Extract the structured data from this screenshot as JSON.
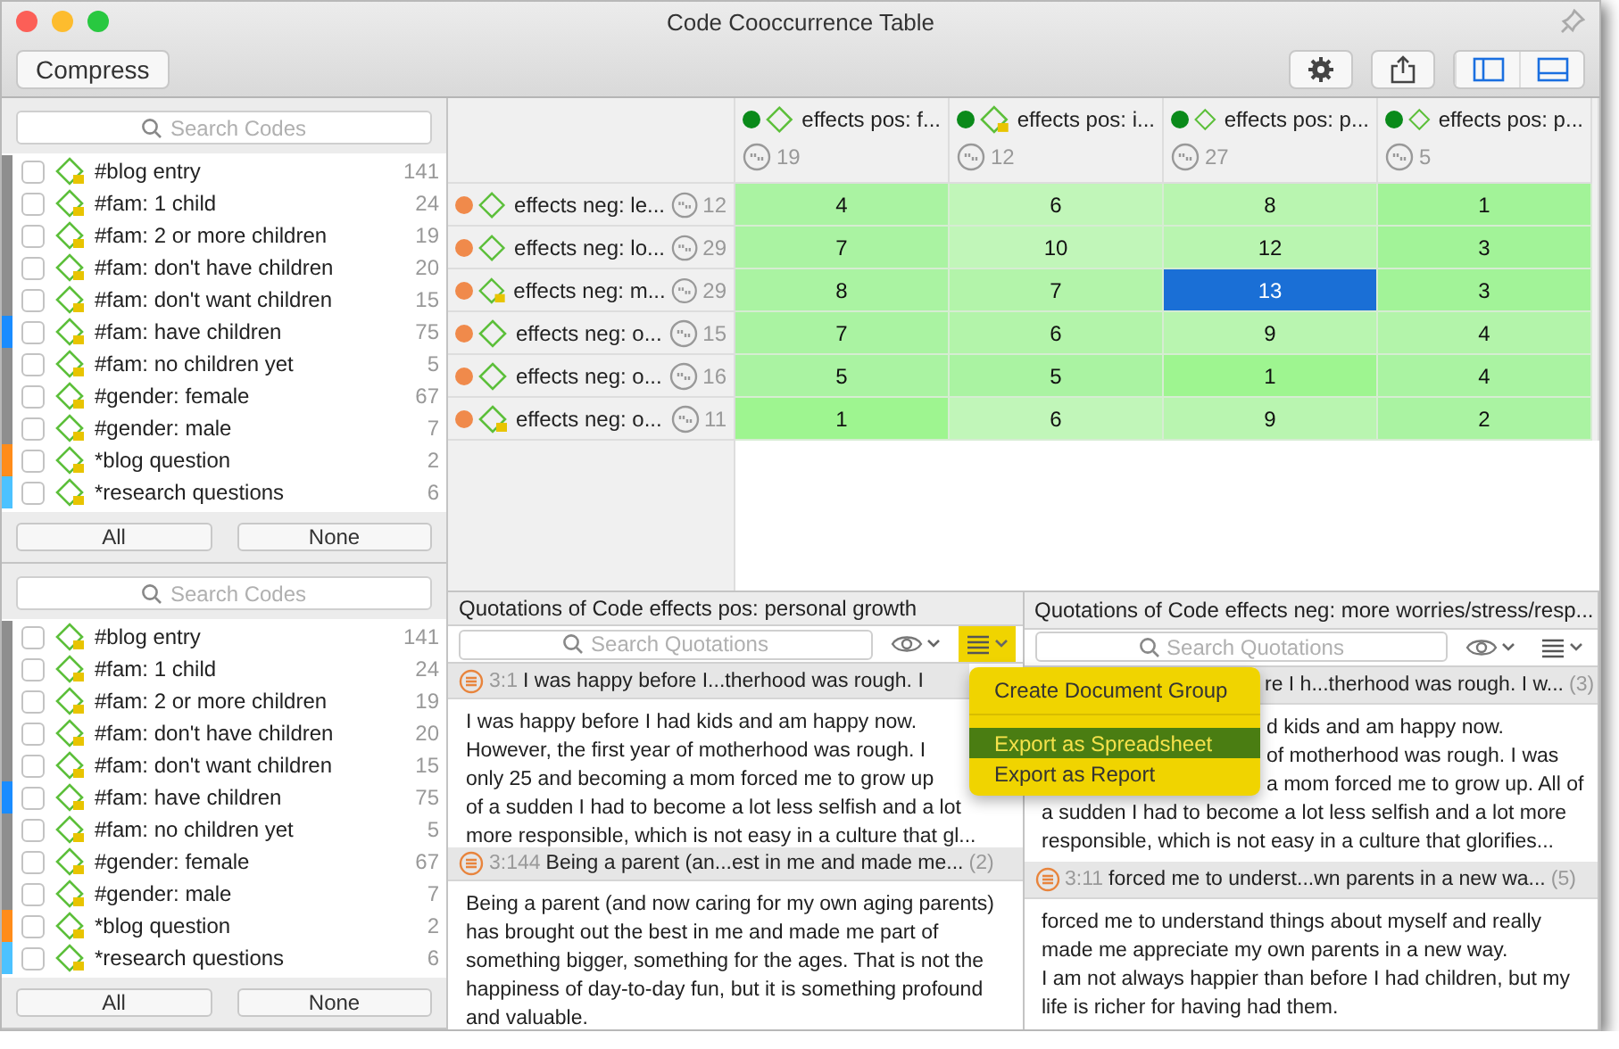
{
  "window": {
    "title": "Code Cooccurrence Table"
  },
  "toolbar": {
    "compress": "Compress",
    "panels": [
      {
        "kind": "left",
        "selected": true
      },
      {
        "kind": "bottom",
        "selected": true
      }
    ]
  },
  "code_lists": [
    {
      "search_placeholder": "Search Codes",
      "all": "All",
      "none": "None",
      "items": [
        {
          "name": "#blog entry",
          "count": "141",
          "color": "#8e8e8e",
          "checked": false,
          "memo": true
        },
        {
          "name": "#fam: 1 child",
          "count": "24",
          "color": "#8e8e8e",
          "checked": false,
          "memo": true
        },
        {
          "name": "#fam: 2 or more children",
          "count": "19",
          "color": "#8e8e8e",
          "checked": false,
          "memo": true
        },
        {
          "name": "#fam: don't have children",
          "count": "20",
          "color": "#8e8e8e",
          "checked": false,
          "memo": true
        },
        {
          "name": "#fam: don't want children",
          "count": "15",
          "color": "#8e8e8e",
          "checked": false,
          "memo": true
        },
        {
          "name": "#fam: have children",
          "count": "75",
          "color": "#1a8cff",
          "checked": false,
          "memo": true
        },
        {
          "name": "#fam: no children yet",
          "count": "5",
          "color": "#8e8e8e",
          "checked": false,
          "memo": true
        },
        {
          "name": "#gender: female",
          "count": "67",
          "color": "#8e8e8e",
          "checked": false,
          "memo": true
        },
        {
          "name": "#gender: male",
          "count": "7",
          "color": "#8e8e8e",
          "checked": false,
          "memo": true
        },
        {
          "name": "*blog question",
          "count": "2",
          "color": "#ff8c1a",
          "checked": false,
          "memo": true
        },
        {
          "name": "*research questions",
          "count": "6",
          "color": "#4cc2ff",
          "checked": false,
          "memo": true
        }
      ]
    },
    {
      "search_placeholder": "Search Codes",
      "all": "All",
      "none": "None",
      "items": [
        {
          "name": "#blog entry",
          "count": "141",
          "color": "#8e8e8e",
          "checked": false,
          "memo": true
        },
        {
          "name": "#fam: 1 child",
          "count": "24",
          "color": "#8e8e8e",
          "checked": false,
          "memo": true
        },
        {
          "name": "#fam: 2 or more children",
          "count": "19",
          "color": "#8e8e8e",
          "checked": false,
          "memo": true
        },
        {
          "name": "#fam: don't have children",
          "count": "20",
          "color": "#8e8e8e",
          "checked": false,
          "memo": true
        },
        {
          "name": "#fam: don't want children",
          "count": "15",
          "color": "#8e8e8e",
          "checked": false,
          "memo": true
        },
        {
          "name": "#fam: have children",
          "count": "75",
          "color": "#1a8cff",
          "checked": false,
          "memo": true
        },
        {
          "name": "#fam: no children yet",
          "count": "5",
          "color": "#8e8e8e",
          "checked": false,
          "memo": true
        },
        {
          "name": "#gender: female",
          "count": "67",
          "color": "#8e8e8e",
          "checked": false,
          "memo": true
        },
        {
          "name": "#gender: male",
          "count": "7",
          "color": "#8e8e8e",
          "checked": false,
          "memo": true
        },
        {
          "name": "*blog question",
          "count": "2",
          "color": "#ff8c1a",
          "checked": false,
          "memo": true
        },
        {
          "name": "*research questions",
          "count": "6",
          "color": "#4cc2ff",
          "checked": false,
          "memo": true
        }
      ]
    }
  ],
  "matrix": {
    "columns": [
      {
        "name": "effects pos: f...",
        "count": "19",
        "color": "#0a8a1a",
        "memo": false
      },
      {
        "name": "effects pos: i...",
        "count": "12",
        "color": "#0a8a1a",
        "memo": true
      },
      {
        "name": "effects pos: p...",
        "count": "27",
        "color": "#0a8a1a",
        "memo": false
      },
      {
        "name": "effects pos: p...",
        "count": "5",
        "color": "#0a8a1a",
        "memo": false
      }
    ],
    "rows": [
      {
        "name": "effects neg: le...",
        "count": "12",
        "color": "#f08a4b",
        "memo": false,
        "cells": [
          {
            "value": "4",
            "color": "#aaf3a2",
            "selected": false
          },
          {
            "value": "6",
            "color": "#c1f6b9",
            "selected": false
          },
          {
            "value": "8",
            "color": "#b9f5b0",
            "selected": false
          },
          {
            "value": "1",
            "color": "#a2f398",
            "selected": false
          }
        ]
      },
      {
        "name": "effects neg: lo...",
        "count": "29",
        "color": "#f08a4b",
        "memo": false,
        "cells": [
          {
            "value": "7",
            "color": "#aaf3a2",
            "selected": false
          },
          {
            "value": "10",
            "color": "#c1f6b9",
            "selected": false
          },
          {
            "value": "12",
            "color": "#b9f5b0",
            "selected": false
          },
          {
            "value": "3",
            "color": "#a2f398",
            "selected": false
          }
        ]
      },
      {
        "name": "effects neg: m...",
        "count": "29",
        "color": "#f08a4b",
        "memo": true,
        "cells": [
          {
            "value": "8",
            "color": "#aaf3a2",
            "selected": false
          },
          {
            "value": "7",
            "color": "#b3f4aa",
            "selected": false
          },
          {
            "value": "13",
            "selected": true
          },
          {
            "value": "3",
            "color": "#a2f398",
            "selected": false
          }
        ]
      },
      {
        "name": "effects neg: o...",
        "count": "15",
        "color": "#f08a4b",
        "memo": false,
        "cells": [
          {
            "value": "7",
            "color": "#aaf3a2",
            "selected": false
          },
          {
            "value": "6",
            "color": "#b3f4aa",
            "selected": false
          },
          {
            "value": "9",
            "color": "#b9f5b0",
            "selected": false
          },
          {
            "value": "4",
            "color": "#b3f4aa",
            "selected": false
          }
        ]
      },
      {
        "name": "effects neg: o...",
        "count": "16",
        "color": "#f08a4b",
        "memo": false,
        "cells": [
          {
            "value": "5",
            "color": "#aaf3a2",
            "selected": false
          },
          {
            "value": "5",
            "color": "#aaf3a2",
            "selected": false
          },
          {
            "value": "1",
            "color": "#9ef590",
            "selected": false
          },
          {
            "value": "4",
            "color": "#aaf3a2",
            "selected": false
          }
        ]
      },
      {
        "name": "effects neg: o...",
        "count": "11",
        "color": "#f08a4b",
        "memo": true,
        "cells": [
          {
            "value": "1",
            "color": "#9ef590",
            "selected": false
          },
          {
            "value": "6",
            "color": "#c1f6b9",
            "selected": false
          },
          {
            "value": "9",
            "color": "#b9f5b0",
            "selected": false
          },
          {
            "value": "2",
            "color": "#aaf3a2",
            "selected": false
          }
        ]
      }
    ]
  },
  "quotation_panes": [
    {
      "title": "Quotations of Code effects pos: personal growth",
      "search_placeholder": "Search Quotations",
      "quotes": [
        {
          "id": "3:1",
          "title": "I was happy before I...therhood was rough. I",
          "lines": [
            "I was happy before I had kids and am happy now.",
            "However, the first year of motherhood was rough. I",
            "only 25 and becoming a mom forced me to grow up",
            "of a sudden I had to become a lot less selfish and a lot",
            "more responsible, which is not easy in a culture that gl..."
          ]
        },
        {
          "id": "3:144",
          "title": "Being a parent (an...est in me and made me...",
          "count": "(2)",
          "paragraphs": [
            "Being a parent (and now caring for my own aging parents) has brought out the best in me and made me part of something bigger, something for the ages. That is not the happiness of day-to-day fun, but it is something profound and valuable."
          ]
        }
      ]
    },
    {
      "title": "Quotations of Code effects neg: more worries/stress/resp...",
      "search_placeholder": "Search Quotations",
      "quotes": [
        {
          "title": "re I h...therhood was rough. I w...",
          "count": "(3)",
          "lines": [
            "d kids and am happy now.",
            "of motherhood was rough. I was",
            "a mom forced me to grow up. All of",
            "a sudden I had to become a lot less selfish and a lot more",
            "responsible, which is not easy in a culture that glorifies..."
          ]
        },
        {
          "id": "3:11",
          "title": "forced me to underst...wn parents in a new wa...",
          "count": "(5)",
          "paragraphs": [
            "forced me to understand things about myself and really made me appreciate my own parents in a new way.",
            "I am not always happier than before I had children, but my life is richer for having had them."
          ]
        }
      ]
    }
  ],
  "menu": {
    "items": [
      {
        "label": "Create Document Group",
        "selected": false
      },
      {
        "label": "Export as Spreadsheet",
        "selected": true
      },
      {
        "label": "Export as Report",
        "selected": false
      }
    ]
  }
}
